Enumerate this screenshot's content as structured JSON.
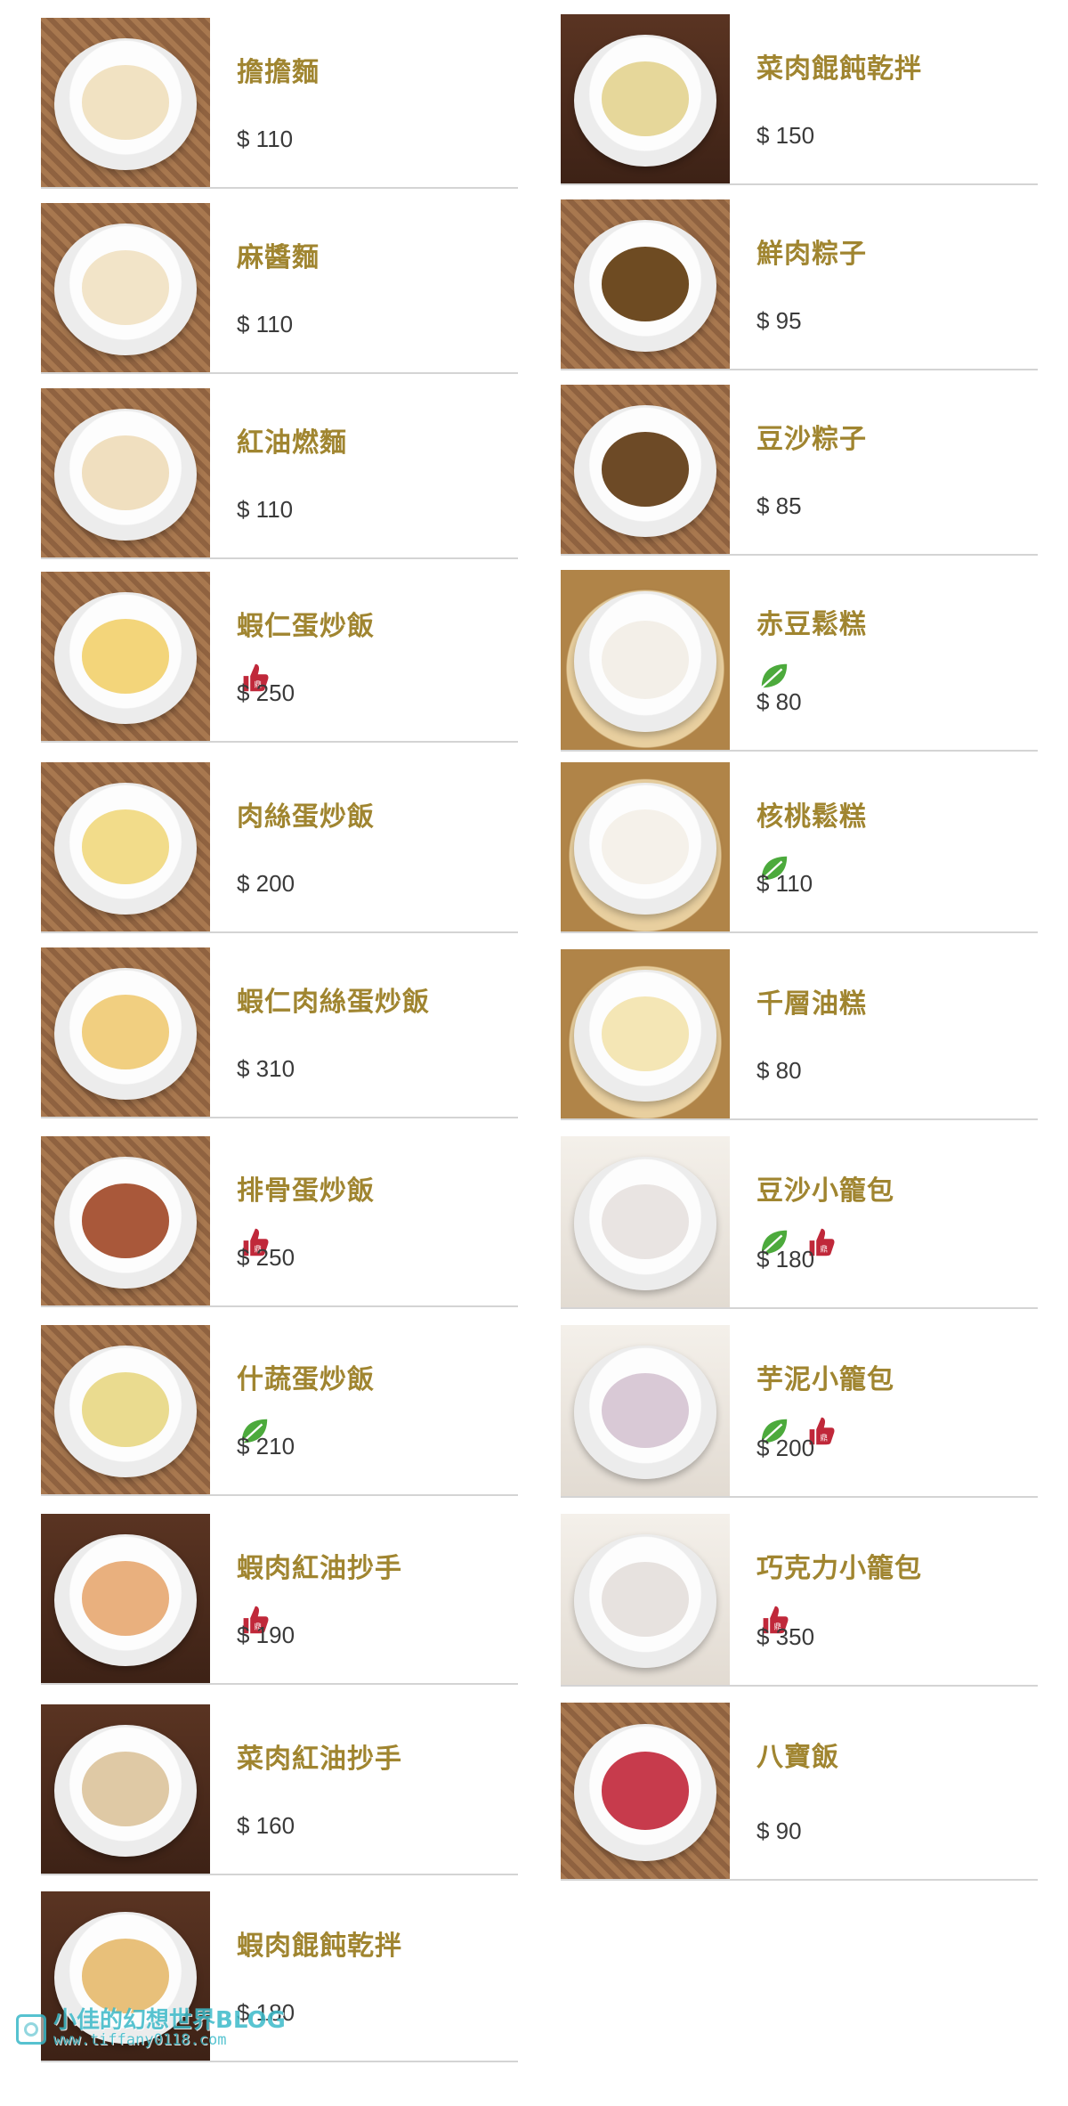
{
  "left_column": [
    {
      "name": "擔擔麵",
      "price": "$ 110",
      "badges": []
    },
    {
      "name": "麻醬麵",
      "price": "$ 110",
      "badges": []
    },
    {
      "name": "紅油燃麵",
      "price": "$ 110",
      "badges": []
    },
    {
      "name": "蝦仁蛋炒飯",
      "price": "$ 250",
      "badges": [
        "thumbs-up-logo-icon"
      ]
    },
    {
      "name": "肉絲蛋炒飯",
      "price": "$ 200",
      "badges": []
    },
    {
      "name": "蝦仁肉絲蛋炒飯",
      "price": "$ 310",
      "badges": []
    },
    {
      "name": "排骨蛋炒飯",
      "price": "$ 250",
      "badges": [
        "thumbs-up-logo-icon"
      ]
    },
    {
      "name": "什蔬蛋炒飯",
      "price": "$ 210",
      "badges": [
        "vegetarian-leaf-icon"
      ]
    },
    {
      "name": "蝦肉紅油抄手",
      "price": "$ 190",
      "badges": [
        "thumbs-up-logo-icon"
      ]
    },
    {
      "name": "菜肉紅油抄手",
      "price": "$ 160",
      "badges": []
    },
    {
      "name": "蝦肉餛飩乾拌",
      "price": "$ 180",
      "badges": []
    }
  ],
  "right_column": [
    {
      "name": "菜肉餛飩乾拌",
      "price": "$ 150",
      "badges": []
    },
    {
      "name": "鮮肉粽子",
      "price": "$ 95",
      "badges": []
    },
    {
      "name": "豆沙粽子",
      "price": "$ 85",
      "badges": []
    },
    {
      "name": "赤豆鬆糕",
      "price": "$ 80",
      "badges": [
        "vegetarian-leaf-icon"
      ]
    },
    {
      "name": "核桃鬆糕",
      "price": "$ 110",
      "badges": [
        "vegetarian-leaf-icon"
      ]
    },
    {
      "name": "千層油糕",
      "price": "$ 80",
      "badges": []
    },
    {
      "name": "豆沙小籠包",
      "price": "$ 180",
      "badges": [
        "vegetarian-leaf-icon",
        "thumbs-up-logo-icon"
      ]
    },
    {
      "name": "芋泥小籠包",
      "price": "$ 200",
      "badges": [
        "vegetarian-leaf-icon",
        "thumbs-up-logo-icon"
      ]
    },
    {
      "name": "巧克力小籠包",
      "price": "$ 350",
      "badges": [
        "thumbs-up-logo-icon"
      ]
    },
    {
      "name": "八寶飯",
      "price": "$ 90",
      "badges": []
    }
  ],
  "watermark": {
    "title": "小佳的幻想世界BLOG",
    "url": "www.tiffany0118.com"
  },
  "colors": {
    "dish_name": "#a08530",
    "price": "#3a3a3a",
    "leaf_badge": "#4caa3c",
    "thumbs_badge": "#c0283a",
    "divider": "#d4d4d4"
  }
}
